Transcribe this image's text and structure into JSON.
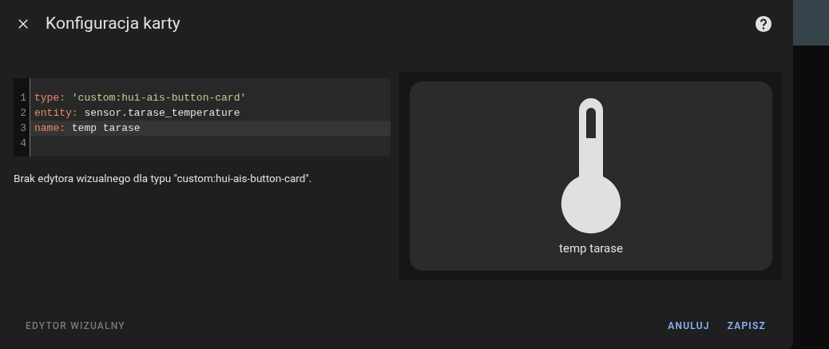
{
  "dialog": {
    "title": "Konfiguracja karty"
  },
  "editor": {
    "lines": [
      {
        "number": "1",
        "key": "type:",
        "value": "'custom:hui-ais-button-card'",
        "kind": "string",
        "active": false
      },
      {
        "number": "2",
        "key": "entity:",
        "value": "sensor.tarase_temperature",
        "kind": "plain",
        "active": false
      },
      {
        "number": "3",
        "key": "name:",
        "value": "temp tarase",
        "kind": "plain",
        "active": true
      },
      {
        "number": "4",
        "active": false
      }
    ]
  },
  "message": "Brak edytora wizualnego dla typu \"custom:hui-ais-button-card\".",
  "preview": {
    "name": "temp tarase"
  },
  "footer": {
    "toggle": {
      "label": "EDYTOR WIZUALNY",
      "disabled": true
    },
    "buttons": [
      "ANULUJ",
      "ZAPISZ"
    ]
  }
}
